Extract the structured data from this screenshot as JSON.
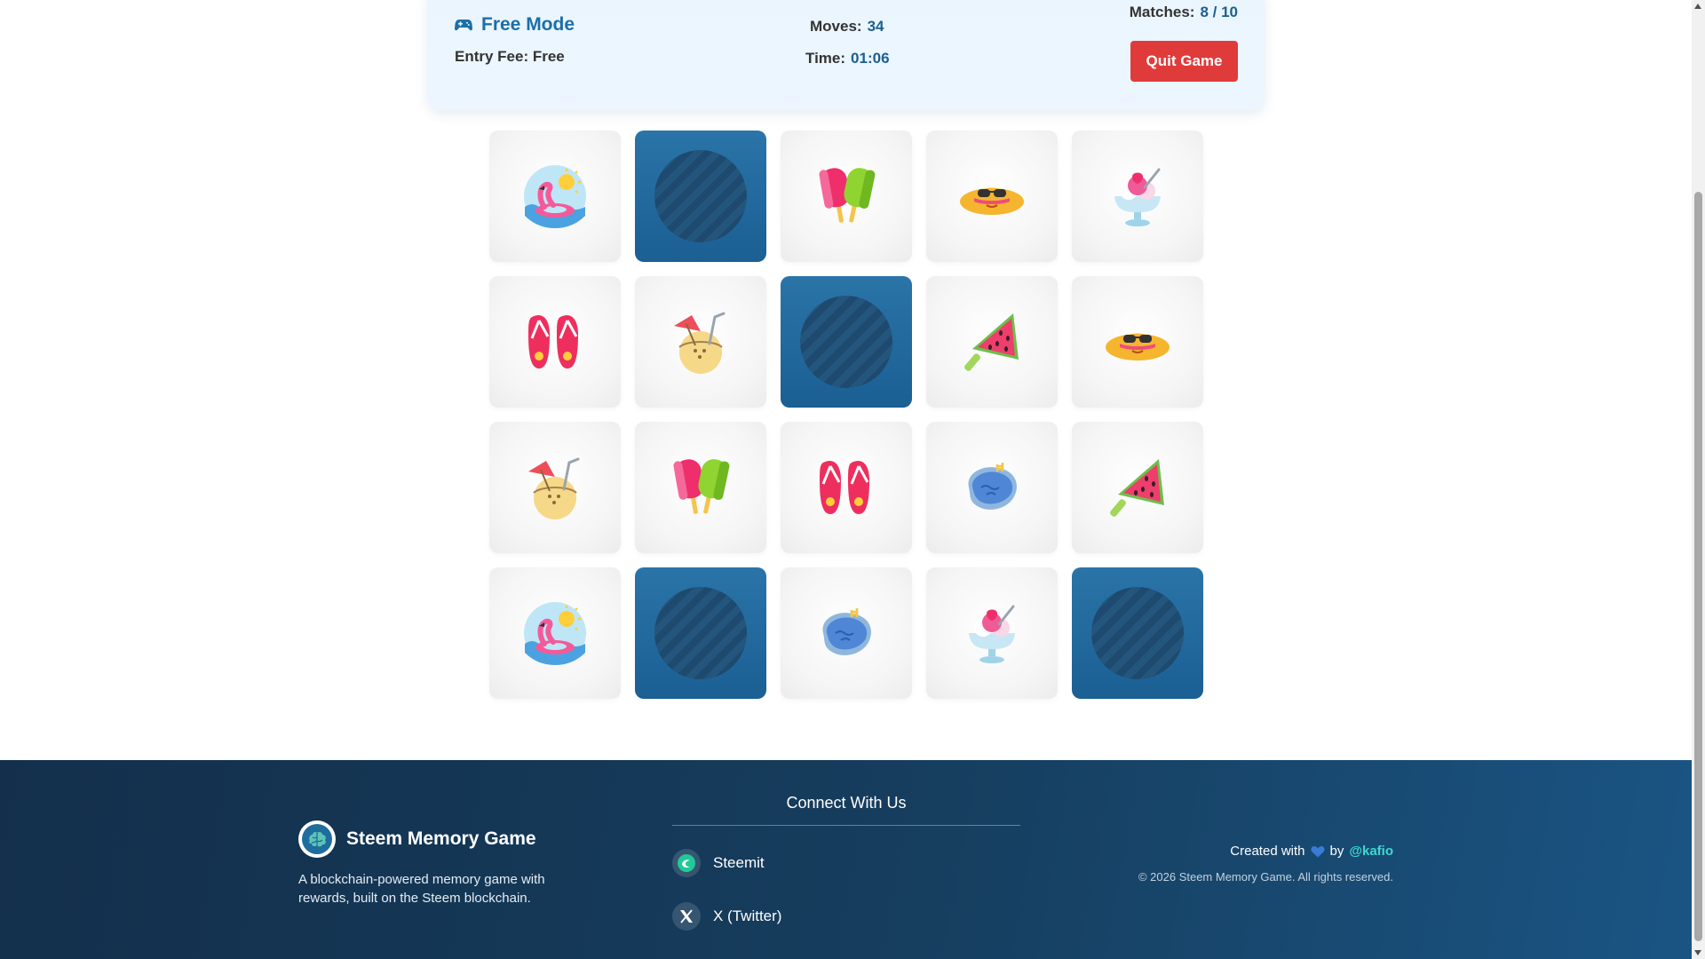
{
  "header": {
    "mode_label": "Free Mode",
    "entry_fee_label": "Entry Fee: Free",
    "moves_label": "Moves:",
    "moves_value": "34",
    "time_label": "Time:",
    "time_value": "01:06",
    "matches_label": "Matches:",
    "matches_value": "8 / 10",
    "quit_label": "Quit Game"
  },
  "board": {
    "columns": 5,
    "rows": 4,
    "cards": [
      "flamingo-float-icon",
      "hidden",
      "popsicles-icon",
      "sunhat-icon",
      "ice-cream-sundae-icon",
      "flip-flops-icon",
      "coconut-drink-icon",
      "hidden",
      "watermelon-popsicle-icon",
      "sunhat-icon",
      "coconut-drink-icon",
      "popsicles-icon",
      "flip-flops-icon",
      "pool-icon",
      "watermelon-popsicle-icon",
      "flamingo-float-icon",
      "hidden",
      "pool-icon",
      "ice-cream-sundae-icon",
      "hidden"
    ]
  },
  "footer": {
    "brand_name": "Steem Memory Game",
    "brand_description": "A blockchain-powered memory game with rewards, built on the Steem blockchain.",
    "connect_title": "Connect With Us",
    "social_links": [
      {
        "label": "Steemit",
        "icon": "steemit-icon"
      },
      {
        "label": "X (Twitter)",
        "icon": "x-twitter-icon"
      }
    ],
    "created_with": "Created with",
    "by_label": "by",
    "author": "@kafio",
    "copyright": "© 2026 Steem Memory Game. All rights reserved."
  },
  "colors": {
    "accent": "#1b6fa8",
    "quit_button": "#e03b3b",
    "card_back": "#1f66a0",
    "footer_bg": "#163e5f",
    "author_link": "#3fd7d0",
    "heart": "#3a7bd5"
  }
}
